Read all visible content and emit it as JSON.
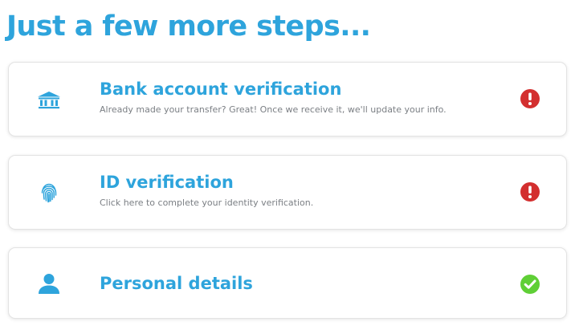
{
  "page": {
    "title": "Just a few more steps..."
  },
  "colors": {
    "accent": "#2ea4dc",
    "error": "#d32f2f",
    "success": "#5fcf36",
    "muted_text": "#7b7f84"
  },
  "steps": [
    {
      "title": "Bank account verification",
      "subtitle": "Already made your transfer? Great! Once we receive it, we'll update your info.",
      "icon": "bank-icon",
      "status": "incomplete",
      "status_icon": "exclamation-circle-icon"
    },
    {
      "title": "ID verification",
      "subtitle": "Click here to complete your identity verification.",
      "icon": "fingerprint-icon",
      "status": "incomplete",
      "status_icon": "exclamation-circle-icon"
    },
    {
      "title": "Personal details",
      "subtitle": "",
      "icon": "user-icon",
      "status": "complete",
      "status_icon": "check-circle-icon"
    }
  ]
}
